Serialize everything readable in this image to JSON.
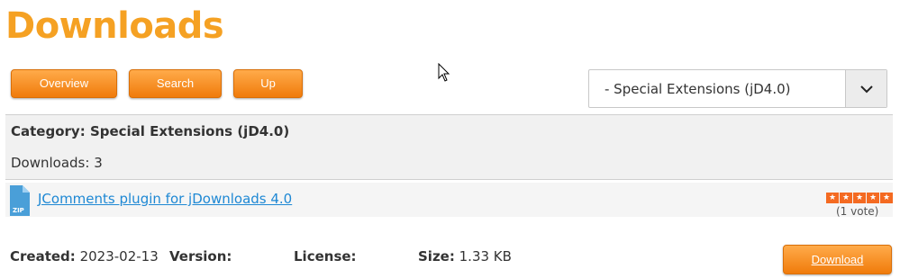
{
  "page": {
    "title": "Downloads"
  },
  "nav": {
    "overview_label": "Overview",
    "search_label": "Search",
    "up_label": "Up"
  },
  "category_select": {
    "value": "- Special Extensions (jD4.0)"
  },
  "category": {
    "label": "Category:",
    "name": "Special Extensions (jD4.0)",
    "downloads_text": "Downloads: 3"
  },
  "item": {
    "title": "JComments plugin for jDownloads 4.0",
    "icon": "zip-file-icon",
    "icon_text": "ZIP",
    "rating_stars": 5,
    "votes_text": "(1 vote)"
  },
  "meta": {
    "created_label": "Created:",
    "created_value": "2023-02-13",
    "version_label": "Version:",
    "version_value": "",
    "license_label": "License:",
    "license_value": "",
    "size_label": "Size:",
    "size_value": "1.33 KB"
  },
  "download_button": {
    "label": "Download"
  },
  "colors": {
    "accent": "#f5a123",
    "button": "#f28a1d",
    "link": "#1e88d4",
    "stars": "#f46a21"
  }
}
